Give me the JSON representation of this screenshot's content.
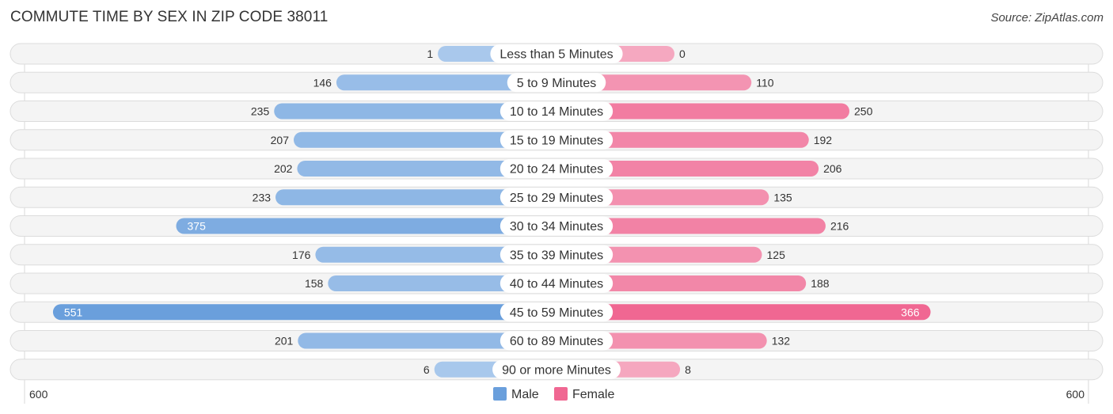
{
  "header": {
    "title": "COMMUTE TIME BY SEX IN ZIP CODE 38011",
    "source": "Source: ZipAtlas.com"
  },
  "colors": {
    "male": "#6a9fdc",
    "male_light": "#a9c8ec",
    "female": "#f06792",
    "female_light": "#f5a8c0"
  },
  "chart_data": {
    "type": "bar",
    "orientation": "horizontal-diverging",
    "title": "COMMUTE TIME BY SEX IN ZIP CODE 38011",
    "categories": [
      "Less than 5 Minutes",
      "5 to 9 Minutes",
      "10 to 14 Minutes",
      "15 to 19 Minutes",
      "20 to 24 Minutes",
      "25 to 29 Minutes",
      "30 to 34 Minutes",
      "35 to 39 Minutes",
      "40 to 44 Minutes",
      "45 to 59 Minutes",
      "60 to 89 Minutes",
      "90 or more Minutes"
    ],
    "series": [
      {
        "name": "Male",
        "values": [
          1,
          146,
          235,
          207,
          202,
          233,
          375,
          176,
          158,
          551,
          201,
          6
        ]
      },
      {
        "name": "Female",
        "values": [
          0,
          110,
          250,
          192,
          206,
          135,
          216,
          125,
          188,
          366,
          132,
          8
        ]
      }
    ],
    "axis": {
      "left_label": "600",
      "right_label": "600",
      "max": 600
    },
    "legend": {
      "position": "bottom-center",
      "items": [
        "Male",
        "Female"
      ]
    },
    "grid": false
  }
}
